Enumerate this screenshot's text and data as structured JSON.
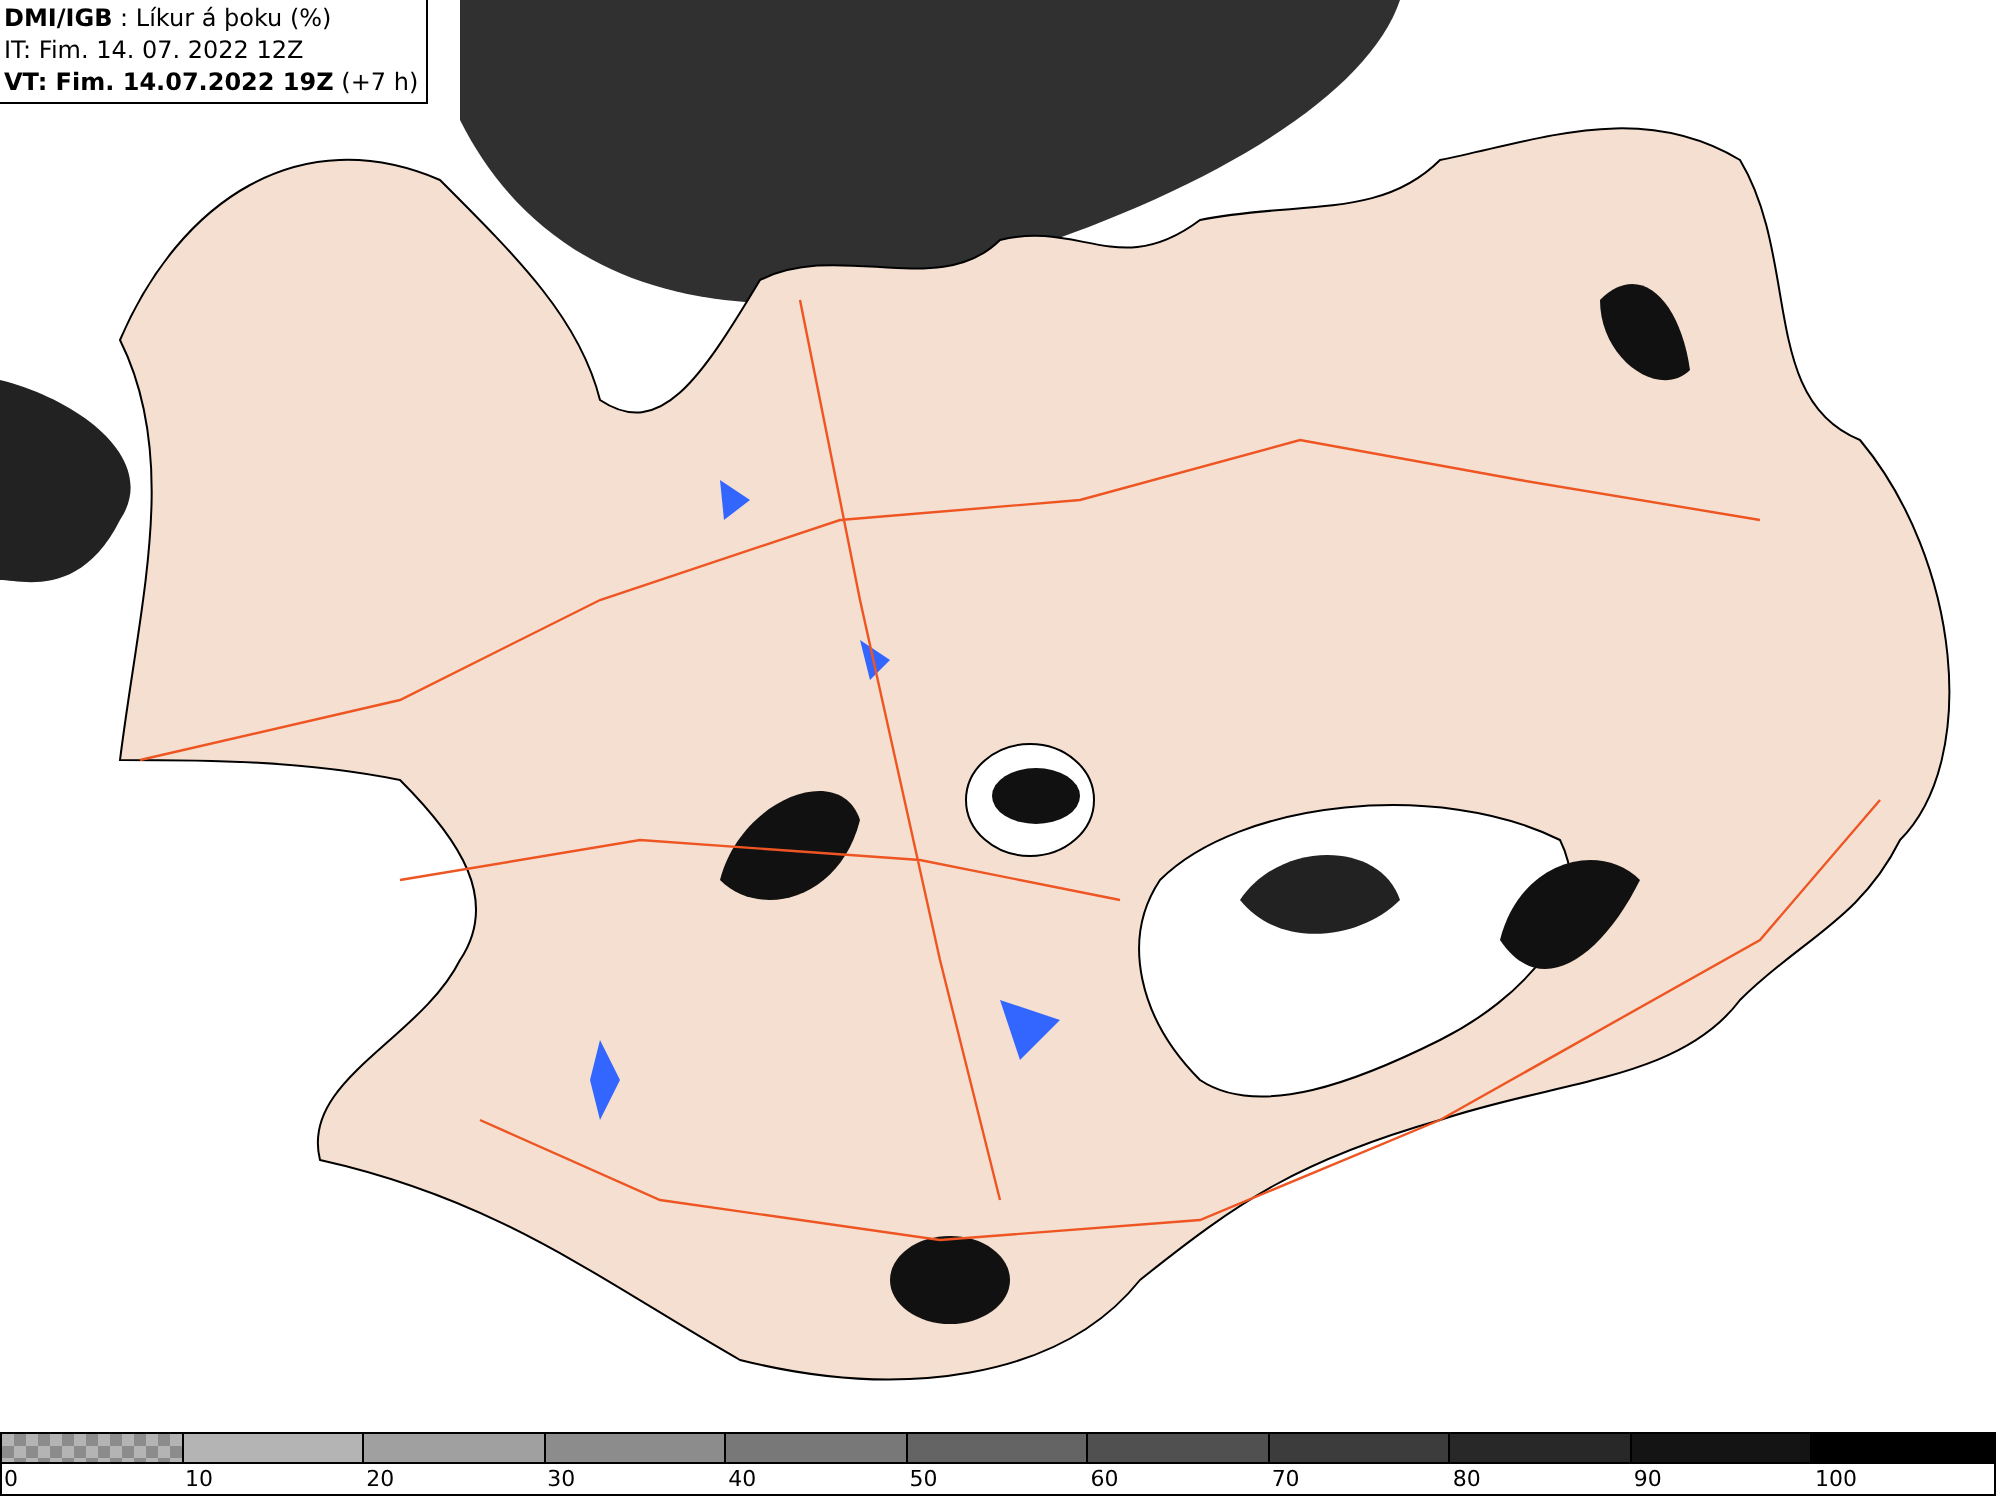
{
  "header": {
    "lines": [
      "**DMI/IGB** : Líkur á þoku (%)",
      "IT: Fim. 14. 07. 2022 12Z",
      "**VT: Fim. 14.07.2022 19Z** (+7 h)"
    ]
  },
  "legend": [
    {
      "kind": "checker",
      "color": "#8c8c8c",
      "label": "0"
    },
    {
      "kind": "solid",
      "color": "#b4b4b4",
      "label": "10"
    },
    {
      "kind": "solid",
      "color": "#a0a0a0",
      "label": "20"
    },
    {
      "kind": "solid",
      "color": "#8c8c8c",
      "label": "30"
    },
    {
      "kind": "solid",
      "color": "#787878",
      "label": "40"
    },
    {
      "kind": "solid",
      "color": "#646464",
      "label": "50"
    },
    {
      "kind": "solid",
      "color": "#505050",
      "label": "60"
    },
    {
      "kind": "solid",
      "color": "#3c3c3c",
      "label": "70"
    },
    {
      "kind": "solid",
      "color": "#282828",
      "label": "80"
    },
    {
      "kind": "solid",
      "color": "#141414",
      "label": "90"
    },
    {
      "kind": "solid",
      "color": "#000000",
      "label": "100"
    }
  ]
}
